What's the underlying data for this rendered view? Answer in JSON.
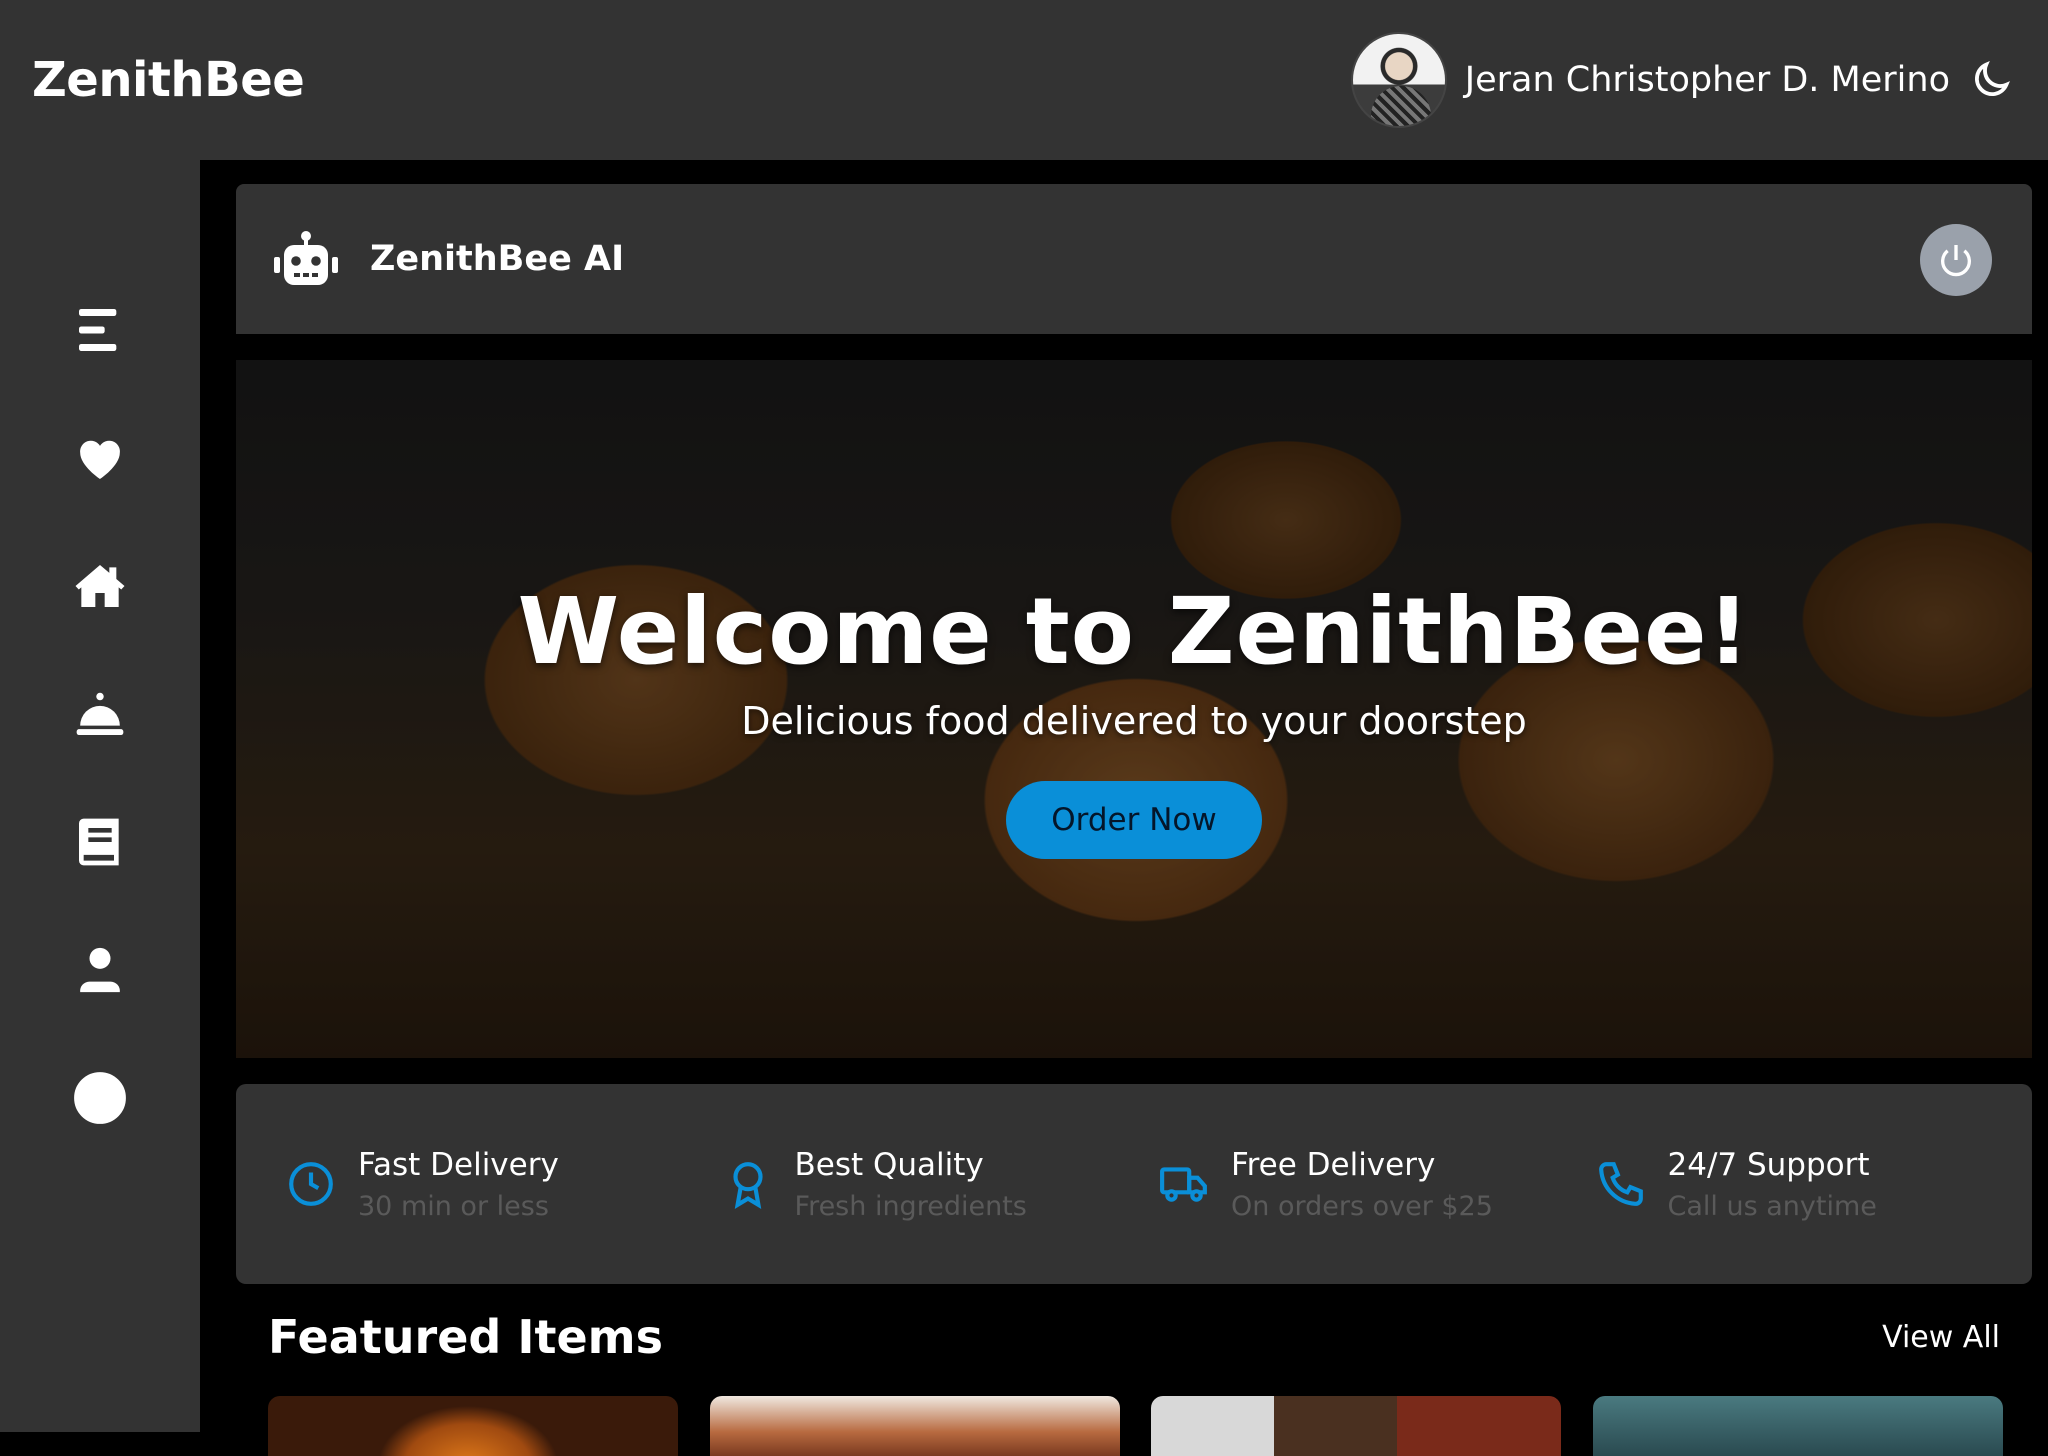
{
  "header": {
    "brand": "ZenithBee",
    "user_name": "Jeran Christopher D. Merino",
    "theme_icon": "moon-icon"
  },
  "sidebar": {
    "items": [
      {
        "icon": "menu-icon"
      },
      {
        "icon": "heart-icon"
      },
      {
        "icon": "home-icon"
      },
      {
        "icon": "bell-service-icon"
      },
      {
        "icon": "book-icon"
      },
      {
        "icon": "user-icon"
      },
      {
        "icon": "power-icon"
      }
    ]
  },
  "ai_bar": {
    "title": "ZenithBee AI",
    "icon": "robot-icon",
    "power_icon": "power-icon"
  },
  "hero": {
    "title": "Welcome to ZenithBee!",
    "subtitle": "Delicious food delivered to your doorstep",
    "cta": "Order Now"
  },
  "features": [
    {
      "icon": "clock-icon",
      "title": "Fast Delivery",
      "desc": "30 min or less"
    },
    {
      "icon": "award-icon",
      "title": "Best Quality",
      "desc": "Fresh ingredients"
    },
    {
      "icon": "truck-icon",
      "title": "Free Delivery",
      "desc": "On orders over $25"
    },
    {
      "icon": "phone-icon",
      "title": "24/7 Support",
      "desc": "Call us anytime"
    }
  ],
  "featured": {
    "title": "Featured Items",
    "view_all": "View All"
  },
  "colors": {
    "accent": "#0a8fd8",
    "panel": "#333333",
    "background": "#000000"
  }
}
